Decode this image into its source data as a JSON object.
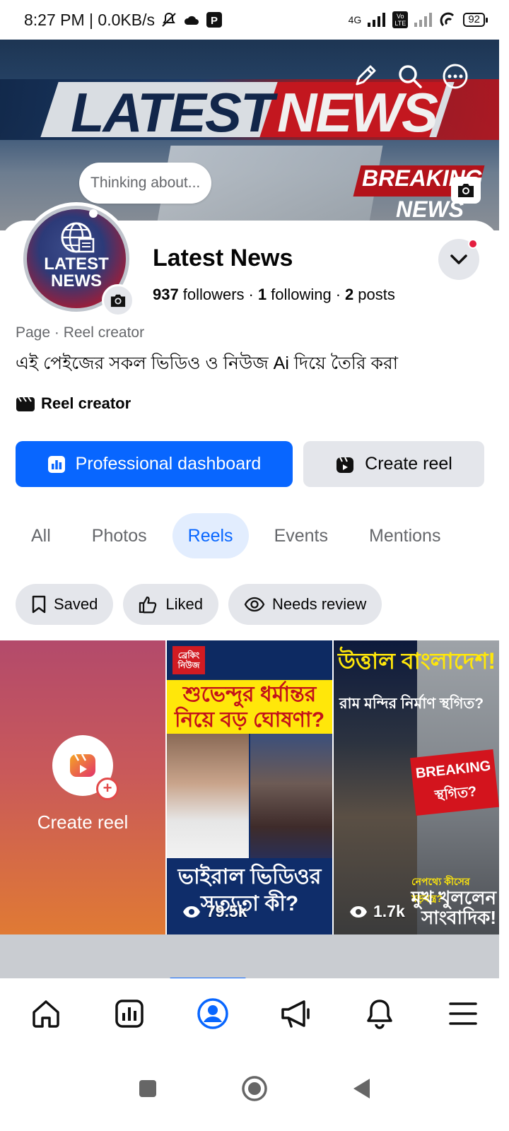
{
  "status_bar": {
    "time_speed": "8:27 PM | 0.0KB/s",
    "network": "4G",
    "volte": "Vo LTE",
    "battery": "92"
  },
  "cover": {
    "headline_a": "LATEST",
    "headline_b": "NEWS",
    "breaking_a": "BREAKING",
    "breaking_b": "NEWS",
    "thinking_placeholder": "Thinking about..."
  },
  "avatar": {
    "line1": "LATEST",
    "line2": "NEWS"
  },
  "profile": {
    "name": "Latest News",
    "followers_count": "937",
    "followers_label": "followers",
    "following_count": "1",
    "following_label": "following",
    "posts_count": "2",
    "posts_label": "posts",
    "category": "Page · Reel creator",
    "bio": "এই পেইজের সকল ভিডিও ও নিউজ Ai দিয়ে তৈরি করা",
    "badge": "Reel creator"
  },
  "actions": {
    "primary": "Professional dashboard",
    "secondary": "Create reel"
  },
  "tabs": [
    {
      "label": "All"
    },
    {
      "label": "Photos"
    },
    {
      "label": "Reels"
    },
    {
      "label": "Events"
    },
    {
      "label": "Mentions"
    }
  ],
  "active_tab": "Reels",
  "filters": [
    {
      "label": "Saved",
      "icon": "bookmark-icon"
    },
    {
      "label": "Liked",
      "icon": "thumbs-up-icon"
    },
    {
      "label": "Needs review",
      "icon": "eye-icon"
    }
  ],
  "grid": {
    "create_label": "Create reel",
    "reels": [
      {
        "badge": "ব্রেকিং নিউজ",
        "headline": "শুভেন্দুর ধর্মান্তর নিয়ে বড় ঘোষণা?",
        "footer": "ভাইরাল ভিডিওর সত্যতা কী?",
        "views": "79.5k"
      },
      {
        "headline": "উত্তাল বাংলাদেশ!",
        "subhead": "রাম মন্দির নির্মাণ স্থগিত?",
        "breaking": "BREAKING স্থগিত?",
        "footer_small": "নেপথ্যে কীসের ষড়যন্ত্র?",
        "footer": "মুখ খুললেন সাংবাদিক!",
        "views": "1.7k"
      }
    ]
  },
  "colors": {
    "accent": "#0866ff",
    "tab_active_bg": "#e2edfe",
    "chip_bg": "#e4e6eb",
    "notification_dot": "#e41e3f"
  }
}
